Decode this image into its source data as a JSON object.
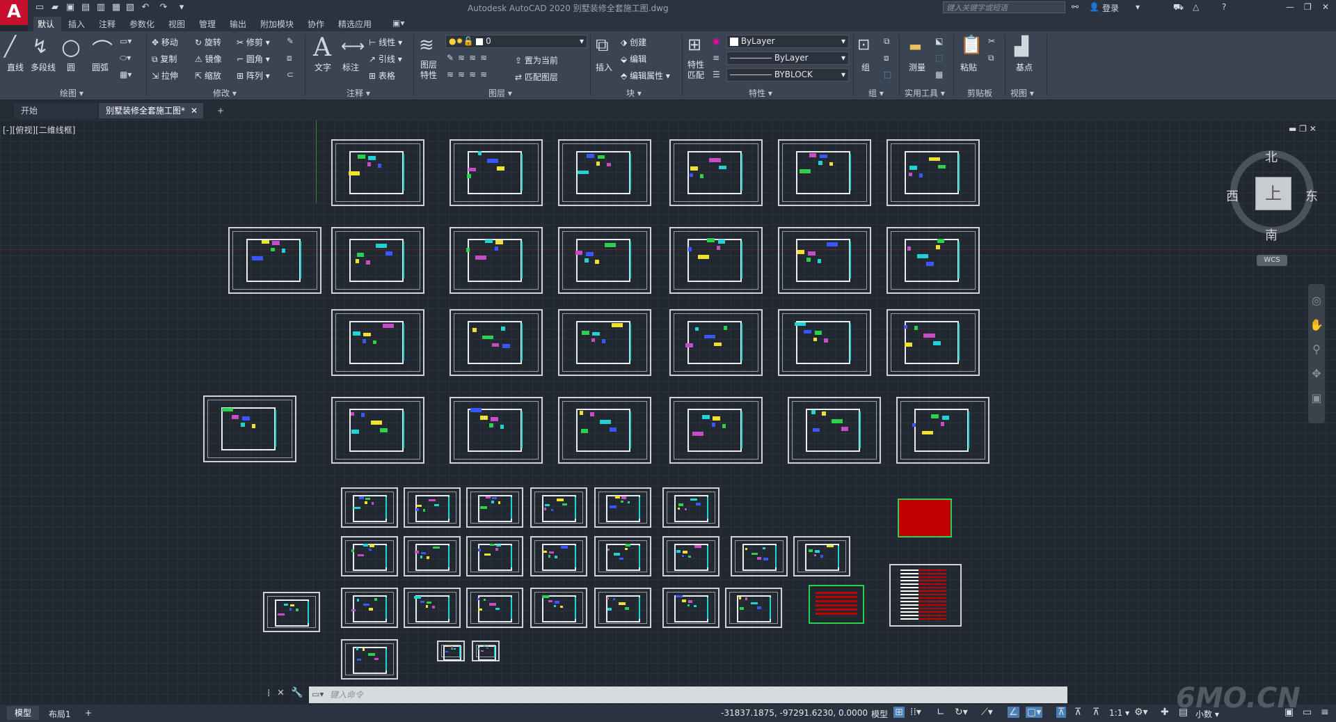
{
  "app": {
    "title": "Autodesk AutoCAD 2020    别墅装修全套施工图.dwg",
    "logo": "A",
    "search_placeholder": "键入关键字或短语",
    "login": "登录"
  },
  "ribbon_tabs": [
    "默认",
    "插入",
    "注释",
    "参数化",
    "视图",
    "管理",
    "输出",
    "附加模块",
    "协作",
    "精选应用"
  ],
  "panels": {
    "draw": {
      "title": "绘图 ▾",
      "items": [
        "直线",
        "多段线",
        "圆",
        "圆弧"
      ]
    },
    "modify": {
      "title": "修改 ▾",
      "items": [
        "移动",
        "旋转",
        "修剪",
        "复制",
        "镜像",
        "圆角",
        "拉伸",
        "缩放",
        "阵列"
      ]
    },
    "annotation": {
      "title": "注释 ▾",
      "items": [
        "文字",
        "标注",
        "线性",
        "引线",
        "表格"
      ]
    },
    "layers": {
      "title": "图层 ▾",
      "layer_props": "图层\n特性",
      "current_layer": "0",
      "set_current": "置为当前",
      "match_layer": "匹配图层"
    },
    "block": {
      "title": "块 ▾",
      "insert": "插入",
      "create": "创建",
      "edit": "编辑",
      "edit_attr": "编辑属性"
    },
    "properties": {
      "title": "特性 ▾",
      "match": "特性\n匹配",
      "color": "ByLayer",
      "linetype": "ByLayer",
      "lineweight": "BYBLOCK"
    },
    "group": {
      "title": "组 ▾",
      "label": "组"
    },
    "utilities": {
      "title": "实用工具 ▾",
      "label": "测量"
    },
    "clipboard": {
      "title": "剪贴板",
      "label": "粘贴"
    },
    "view": {
      "title": "视图 ▾",
      "label": "基点"
    }
  },
  "file_tabs": [
    "开始",
    "别墅装修全套施工图*"
  ],
  "viewport": {
    "label": "[-][俯视][二维线框]"
  },
  "viewcube": {
    "north": "北",
    "south": "南",
    "east": "东",
    "west": "西",
    "top": "上",
    "wcs": "WCS"
  },
  "command": {
    "placeholder": "键入命令"
  },
  "layout_tabs": [
    "模型",
    "布局1"
  ],
  "status": {
    "coords": "-31837.1875, -97291.6230, 0.0000",
    "model": "模型",
    "scale": "1:1",
    "units": "小数"
  },
  "watermark": "6MO.CN"
}
